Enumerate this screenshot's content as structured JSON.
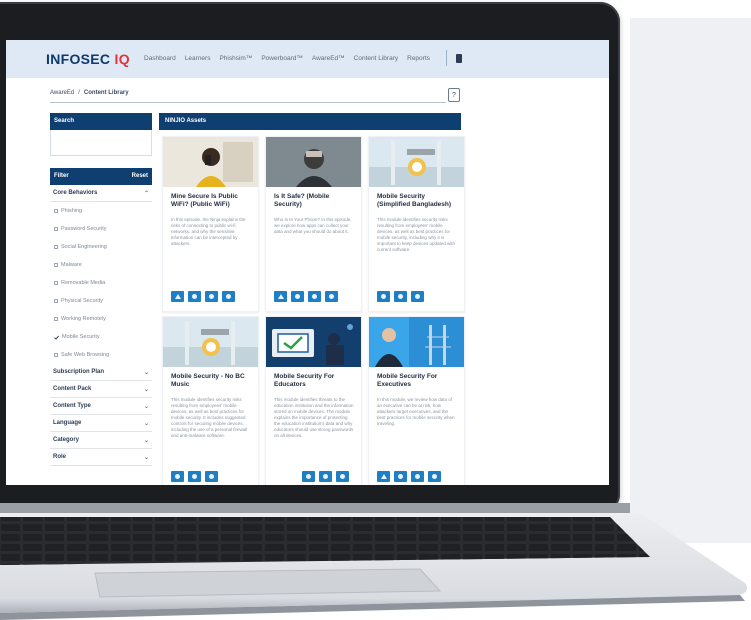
{
  "header": {
    "logo_text": "INFOSEC",
    "logo_accent": "IQ",
    "nav_items": [
      "Dashboard",
      "Learners",
      "Phishsim™",
      "Powerboard™",
      "AwareEd™",
      "Content Library",
      "Reports"
    ],
    "icon": "gear-icon"
  },
  "breadcrumb": {
    "parent": "AwareEd",
    "separator": "/",
    "current": "Content Library"
  },
  "sidebar": {
    "search_label": "Search",
    "filter_label": "Filter",
    "reset_label": "Reset",
    "section_core": "Core Behaviors",
    "items": [
      {
        "label": "Phishing",
        "checked": false
      },
      {
        "label": "Password Security",
        "checked": false
      },
      {
        "label": "Social Engineering",
        "checked": false
      },
      {
        "label": "Malware",
        "checked": false
      },
      {
        "label": "Removable Media",
        "checked": false
      },
      {
        "label": "Physical Security",
        "checked": false
      },
      {
        "label": "Working Remotely",
        "checked": false
      },
      {
        "label": "Mobile Security",
        "checked": true
      },
      {
        "label": "Safe Web Browsing",
        "checked": false
      }
    ],
    "sections": [
      "Subscription Plan",
      "Content Pack",
      "Content Type",
      "Language",
      "Category",
      "Role"
    ]
  },
  "content": {
    "section_title": "NINJIO Assets",
    "cards": [
      {
        "title": "Mine Secure Is Public WiFi? (Public WiFi)",
        "desc": "In this episode, the Ninja explains the risks of connecting to public wi-fi networks, and why the sensitive information can be intercepted by attackers."
      },
      {
        "title": "Is It Safe? (Mobile Security)",
        "desc": "Who Is In Your Phone? In this episode, we explore how apps can collect your data and what you should do about it."
      },
      {
        "title": "Mobile Security (Simplified Bangladesh)",
        "desc": "This module identifies security risks resulting from employees' mobile devices, as well as best practices for mobile security, including why it is important to keep devices updated with current software."
      },
      {
        "title": "Mobile Security - No BC Music",
        "desc": "This module identifies security risks resulting from employees' mobile devices, as well as best practices for mobile security. It includes suggested controls for securing mobile devices, including the use of a personal firewall and anti-malware software."
      },
      {
        "title": "Mobile Security For Educators",
        "desc": "This module identifies threats to the education institution and the information stored on mobile devices. The module explains the importance of protecting the education institution's data and why educators should use strong passwords on all devices."
      },
      {
        "title": "Mobile Security For Executives",
        "desc": "In this module, we review how data of an executive can be at risk, how attackers target executives, and the best practices for mobile security when traveling."
      }
    ]
  },
  "colors": {
    "brand_navy": "#0f3f71",
    "accent_blue": "#1e7fc6",
    "logo_red": "#e2343a",
    "header_bg": "#dfe9f5"
  }
}
